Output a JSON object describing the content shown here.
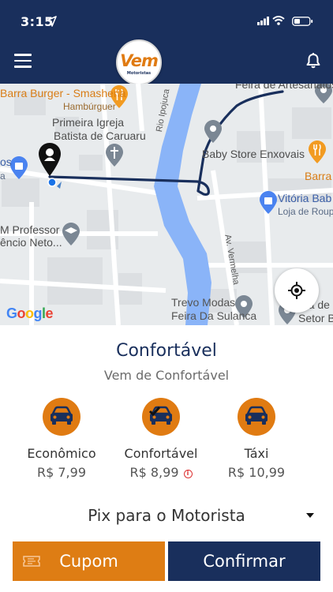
{
  "status_bar": {
    "time": "3:15"
  },
  "header": {
    "logo_text": "Vem",
    "logo_subtext": "Motoristas",
    "menu_icon": "hamburger-icon",
    "bell_icon": "bell-icon"
  },
  "map": {
    "labels": {
      "place1": "Feira de Artesanatos de Caruaru",
      "place2": "Barra Burger - Smasheria",
      "place2_sub": "Hambúrguer",
      "place3_line1": "Primeira Igreja",
      "place3_line2": "Batista de Caruaru",
      "river": "Rio Ipojuca",
      "place4": "Baby Store Enxovais",
      "place5": "Barra",
      "place6": "Vitória Bab",
      "place6_sub": "Loja de Roupa",
      "place7_line1": "M Professor",
      "place7_line2": "êncio Neto...",
      "road": "Av. Vermelha",
      "place8_line1": "Trevo Modas",
      "place8_line2": "Feira Da Sulanca",
      "place9_line1": "ra de",
      "place9_line2": "Setor B",
      "edge_s": "os",
      "edge_a": "a"
    },
    "google": "Google",
    "route_color": "#192f5c"
  },
  "ride": {
    "title": "Confortável",
    "subtitle": "Vem de Confortável",
    "options": [
      {
        "name": "Econômico",
        "price": "R$ 7,99"
      },
      {
        "name": "Confortável",
        "price": "R$ 8,99"
      },
      {
        "name": "Táxi",
        "price": "R$ 10,99"
      }
    ],
    "selected": "Confortável"
  },
  "payment": {
    "method": "Pix para o Motorista"
  },
  "buttons": {
    "coupon": "Cupom",
    "confirm": "Confirmar"
  },
  "colors": {
    "navy": "#192f5c",
    "orange": "#e07b12"
  }
}
